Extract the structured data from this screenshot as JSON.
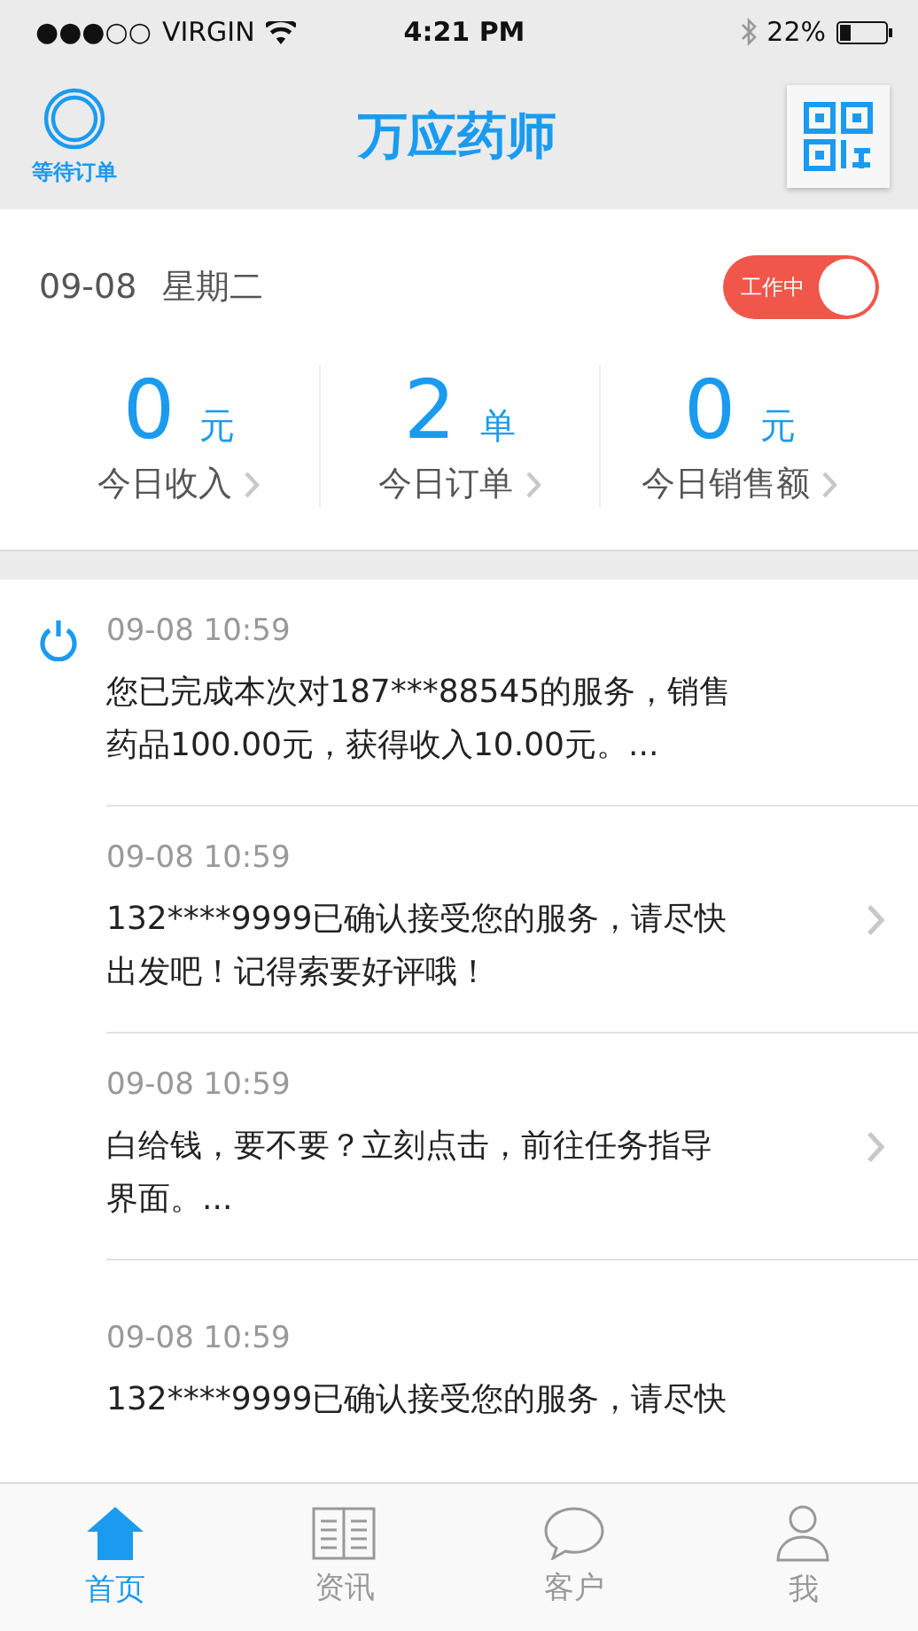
{
  "status_bar": {
    "signal": "●●●○○",
    "carrier": "VIRGIN",
    "time": "4:21 PM",
    "battery": "22%"
  },
  "header": {
    "left_label": "等待订单",
    "title": "万应药师"
  },
  "summary": {
    "date": "09-08",
    "weekday": "星期二",
    "work_toggle": {
      "label": "工作中",
      "on": true
    },
    "stats": [
      {
        "value": "0",
        "unit": "元",
        "label": "今日收入"
      },
      {
        "value": "2",
        "unit": "单",
        "label": "今日订单"
      },
      {
        "value": "0",
        "unit": "元",
        "label": "今日销售额"
      }
    ]
  },
  "feed": [
    {
      "time": "09-08 10:59",
      "text": "您已完成本次对187***88545的服务，销售药品100.00元，获得收入10.00元。...",
      "active": true,
      "linked": false
    },
    {
      "time": "09-08 10:59",
      "text": "132****9999已确认接受您的服务，请尽快出发吧！记得索要好评哦！",
      "active": false,
      "linked": true
    },
    {
      "time": "09-08 10:59",
      "text": "白给钱，要不要？立刻点击，前往任务指导界面。...",
      "active": false,
      "linked": true
    },
    {
      "time": "09-08 10:59",
      "text": "132****9999已确认接受您的服务，请尽快",
      "active": false,
      "linked": false
    }
  ],
  "tabs": [
    {
      "label": "首页",
      "kind": "home",
      "selected": true
    },
    {
      "label": "资讯",
      "kind": "news",
      "selected": false
    },
    {
      "label": "客户",
      "kind": "chat",
      "selected": false
    },
    {
      "label": "我",
      "kind": "profile",
      "selected": false
    }
  ]
}
